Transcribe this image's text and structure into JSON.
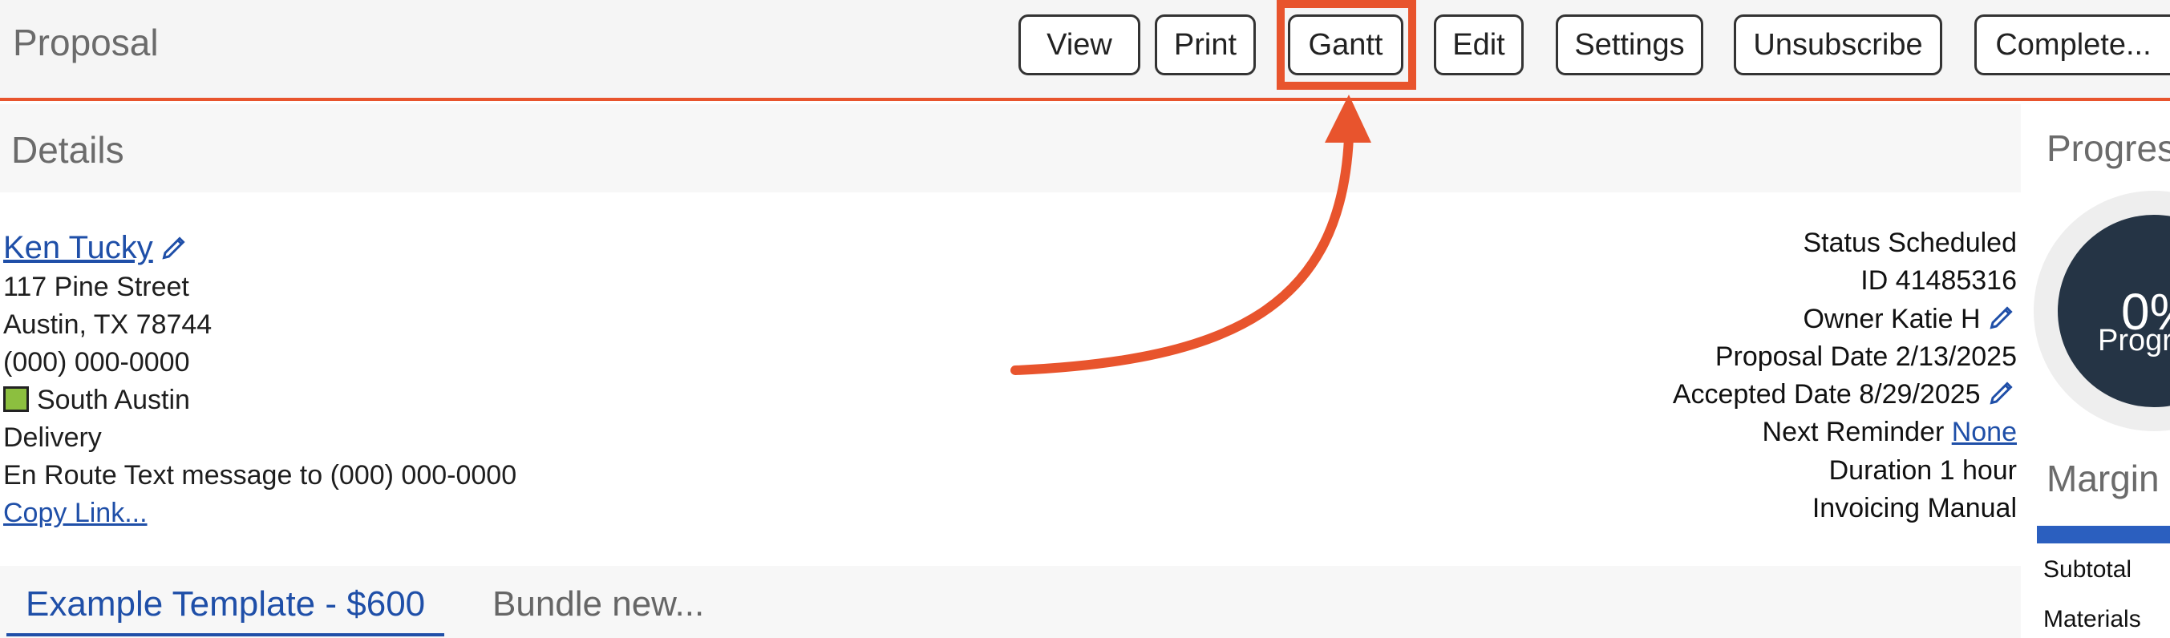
{
  "header": {
    "title": "Proposal",
    "buttons": {
      "view": "View",
      "print": "Print",
      "gantt": "Gantt",
      "edit": "Edit",
      "settings": "Settings",
      "unsubscribe": "Unsubscribe",
      "complete": "Complete..."
    }
  },
  "details": {
    "title": "Details",
    "customer": {
      "name": "Ken Tucky",
      "street": "117 Pine Street",
      "city": "Austin, TX 78744",
      "phone": "(000) 000-0000",
      "location": "South Austin",
      "location_color": "#8cbf3f",
      "service": "Delivery",
      "en_route": "En Route Text message to (000) 000-0000",
      "copy_link": "Copy Link..."
    },
    "info": {
      "status": "Status Scheduled",
      "id": "ID 41485316",
      "owner": "Owner Katie H",
      "proposal_date": "Proposal Date 2/13/2025",
      "accepted_date": "Accepted Date 8/29/2025",
      "next_reminder_label": "Next Reminder",
      "next_reminder_value": "None",
      "duration": "Duration 1 hour",
      "invoicing": "Invoicing Manual"
    }
  },
  "tabs": {
    "active": "Example Template - $600",
    "other": "Bundle new..."
  },
  "progress": {
    "title": "Progres",
    "percent": "0%",
    "label": "Progr"
  },
  "margin": {
    "title": "Margin",
    "rows": [
      "Subtotal",
      "Materials"
    ]
  },
  "colors": {
    "accent": "#e8542d",
    "link": "#1f4fa8",
    "progress_circle": "#253445"
  }
}
